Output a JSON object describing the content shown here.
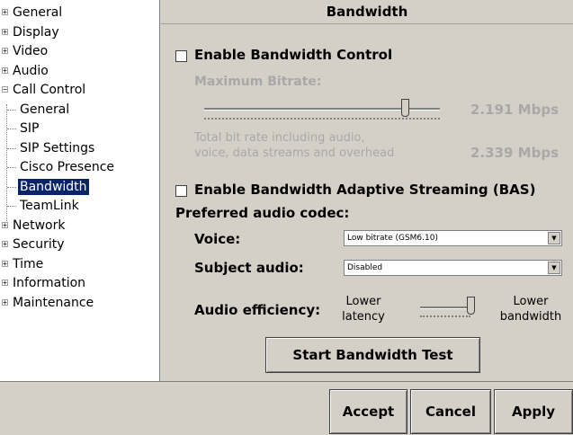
{
  "sidebar": {
    "items": [
      {
        "label": "General",
        "expander": "+"
      },
      {
        "label": "Display",
        "expander": "+"
      },
      {
        "label": "Video",
        "expander": "+"
      },
      {
        "label": "Audio",
        "expander": "+"
      },
      {
        "label": "Call Control",
        "expander": "−"
      },
      {
        "label": "General"
      },
      {
        "label": "SIP"
      },
      {
        "label": "SIP Settings"
      },
      {
        "label": "Cisco Presence"
      },
      {
        "label": "Bandwidth"
      },
      {
        "label": "TeamLink"
      },
      {
        "label": "Network",
        "expander": "+"
      },
      {
        "label": "Security",
        "expander": "+"
      },
      {
        "label": "Time",
        "expander": "+"
      },
      {
        "label": "Information",
        "expander": "+"
      },
      {
        "label": "Maintenance",
        "expander": "+"
      }
    ],
    "selected": "Bandwidth"
  },
  "panel": {
    "title": "Bandwidth",
    "bandwidth_control": {
      "label": "Enable Bandwidth Control",
      "checked": false
    },
    "max_bitrate": {
      "label": "Maximum Bitrate:",
      "value": "2.191 Mbps",
      "level": 0.85
    },
    "total_bitrate": {
      "line1": "Total bit rate including audio,",
      "line2": "voice, data streams and overhead",
      "value": "2.339 Mbps"
    },
    "bas": {
      "label": "Enable Bandwidth Adaptive Streaming (BAS)",
      "checked": false
    },
    "preferred_codec": {
      "label": "Preferred audio codec:"
    },
    "voice": {
      "label": "Voice:",
      "value": "Low bitrate (GSM6.10)"
    },
    "subject_audio": {
      "label": "Subject audio:",
      "value": "Disabled"
    },
    "audio_efficiency": {
      "label": "Audio efficiency:",
      "left1": "Lower",
      "left2": "latency",
      "right1": "Lower",
      "right2": "bandwidth",
      "level": 1.0
    },
    "start_test_button": "Start Bandwidth Test"
  },
  "buttons": {
    "accept": "Accept",
    "cancel": "Cancel",
    "apply": "Apply"
  },
  "colors": {
    "selection": "#0a246a",
    "background": "#d4d0c8",
    "disabled_text": "#a8a8a8"
  }
}
